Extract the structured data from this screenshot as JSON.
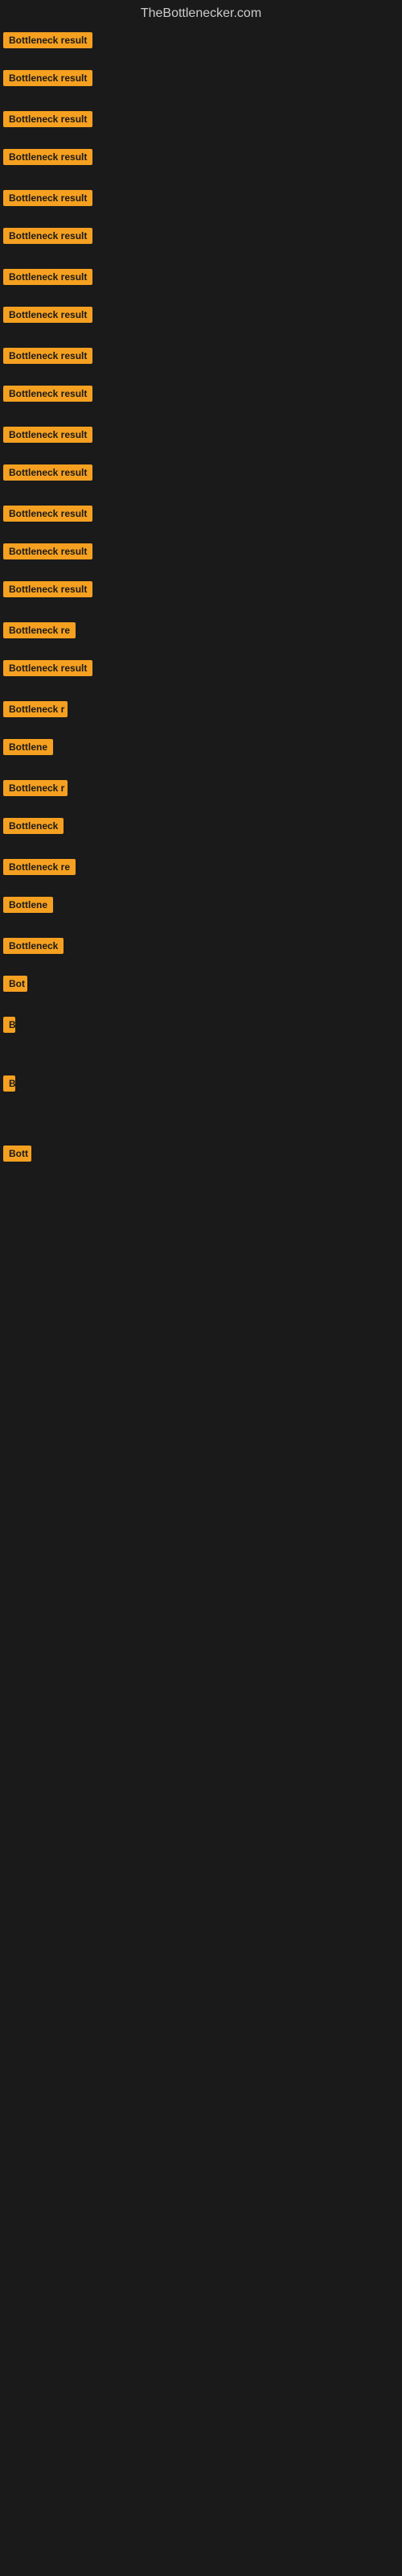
{
  "site": {
    "title": "TheBottlenecker.com"
  },
  "items": [
    {
      "id": 1,
      "label": "Bottleneck result",
      "width": "full"
    },
    {
      "id": 2,
      "label": "Bottleneck result",
      "width": "full"
    },
    {
      "id": 3,
      "label": "Bottleneck result",
      "width": "full"
    },
    {
      "id": 4,
      "label": "Bottleneck result",
      "width": "full"
    },
    {
      "id": 5,
      "label": "Bottleneck result",
      "width": "full"
    },
    {
      "id": 6,
      "label": "Bottleneck result",
      "width": "full"
    },
    {
      "id": 7,
      "label": "Bottleneck result",
      "width": "full"
    },
    {
      "id": 8,
      "label": "Bottleneck result",
      "width": "full"
    },
    {
      "id": 9,
      "label": "Bottleneck result",
      "width": "full"
    },
    {
      "id": 10,
      "label": "Bottleneck result",
      "width": "full"
    },
    {
      "id": 11,
      "label": "Bottleneck result",
      "width": "full"
    },
    {
      "id": 12,
      "label": "Bottleneck result",
      "width": "full"
    },
    {
      "id": 13,
      "label": "Bottleneck result",
      "width": "full"
    },
    {
      "id": 14,
      "label": "Bottleneck result",
      "width": "full"
    },
    {
      "id": 15,
      "label": "Bottleneck result",
      "width": "full"
    },
    {
      "id": 16,
      "label": "Bottleneck re",
      "width": "truncated1"
    },
    {
      "id": 17,
      "label": "Bottleneck result",
      "width": "full"
    },
    {
      "id": 18,
      "label": "Bottleneck r",
      "width": "truncated2"
    },
    {
      "id": 19,
      "label": "Bottlene",
      "width": "truncated3"
    },
    {
      "id": 20,
      "label": "Bottleneck r",
      "width": "truncated2"
    },
    {
      "id": 21,
      "label": "Bottleneck",
      "width": "truncated4"
    },
    {
      "id": 22,
      "label": "Bottleneck re",
      "width": "truncated1"
    },
    {
      "id": 23,
      "label": "Bottlene",
      "width": "truncated3"
    },
    {
      "id": 24,
      "label": "Bottleneck",
      "width": "truncated4"
    },
    {
      "id": 25,
      "label": "Bot",
      "width": "truncated5"
    },
    {
      "id": 26,
      "label": "B",
      "width": "truncated6"
    },
    {
      "id": 27,
      "label": "",
      "width": "empty"
    },
    {
      "id": 28,
      "label": "B",
      "width": "truncated6"
    },
    {
      "id": 29,
      "label": "Bott",
      "width": "truncated7"
    },
    {
      "id": 30,
      "label": "",
      "width": "empty2"
    }
  ]
}
